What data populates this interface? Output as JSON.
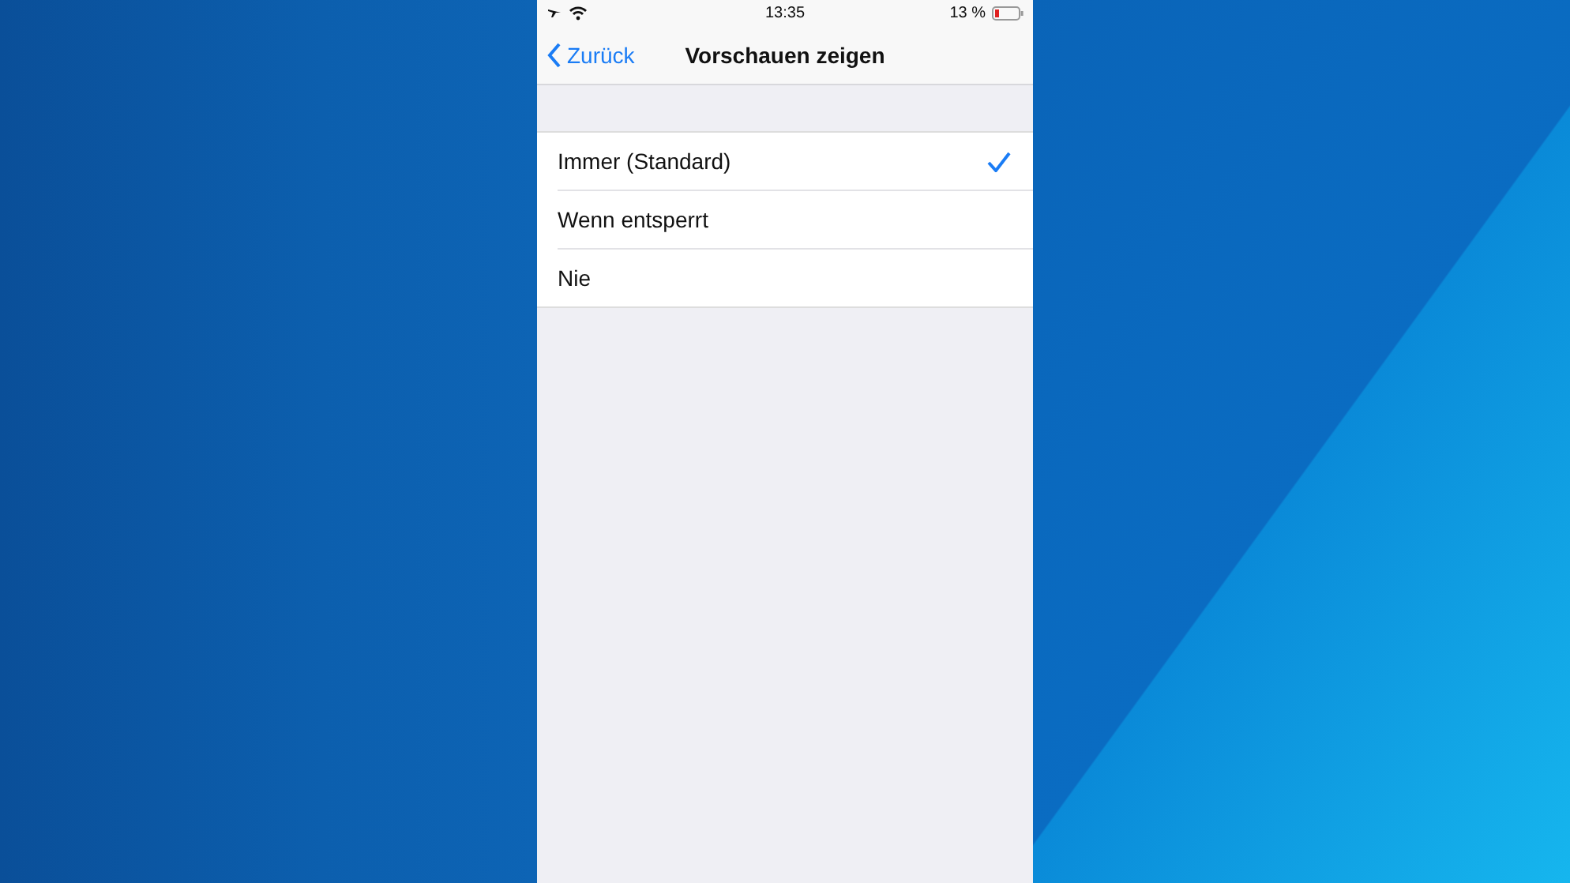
{
  "status_bar": {
    "time": "13:35",
    "battery": "13 %"
  },
  "nav": {
    "back": "Zurück",
    "title": "Vorschauen zeigen"
  },
  "options": [
    {
      "label": "Immer (Standard)",
      "selected": true
    },
    {
      "label": "Wenn entsperrt",
      "selected": false
    },
    {
      "label": "Nie",
      "selected": false
    }
  ]
}
